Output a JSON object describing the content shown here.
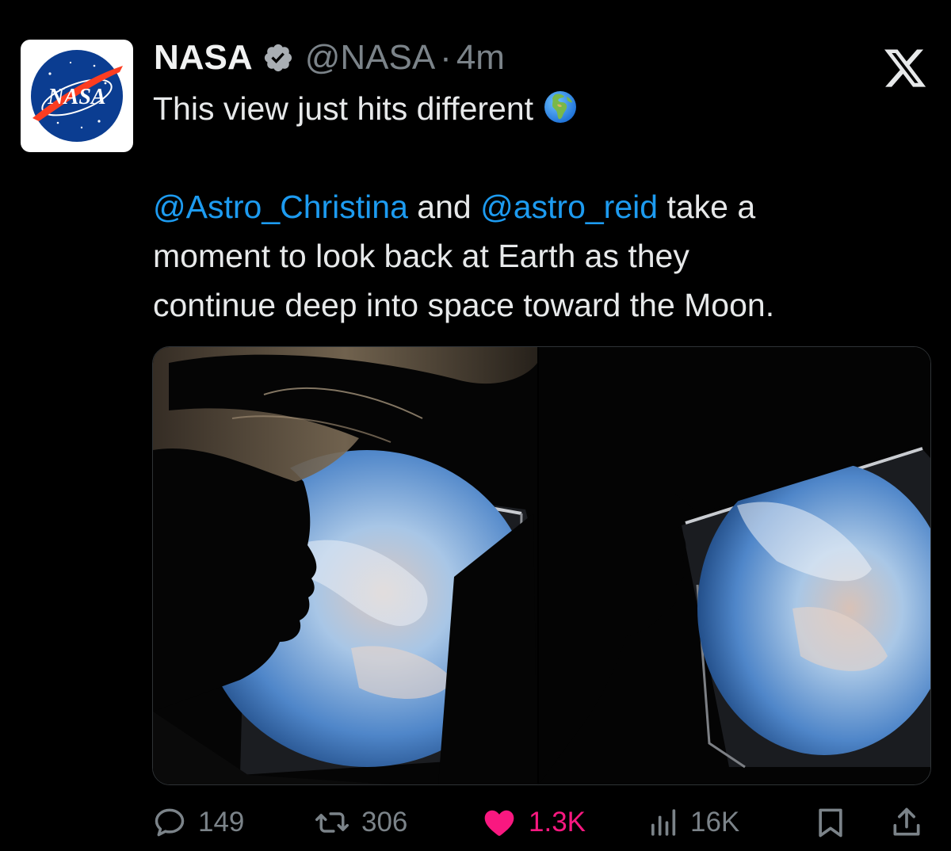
{
  "tweet": {
    "avatar": {
      "alt": "NASA logo",
      "logo_text": "NASA"
    },
    "author": {
      "display_name": "NASA",
      "handle": "@NASA",
      "verified": true
    },
    "separator": "·",
    "timestamp": "4m",
    "text": {
      "headline": "This view just hits different",
      "headline_emoji": "globe-europe-africa-icon",
      "mention_1": "@Astro_Christina",
      "word_and": " and ",
      "mention_2": "@astro_reid",
      "line2_rest": " take a",
      "line3": "moment to look back at Earth as they",
      "line4": "continue deep into space toward the Moon."
    },
    "media": [
      {
        "alt": "Astronaut silhouette in profile looking out an Orion window at Earth"
      },
      {
        "alt": "Second astronaut silhouette in profile looking at Earth through a window"
      }
    ],
    "metrics": {
      "replies": "149",
      "reposts": "306",
      "likes": "1.3K",
      "views": "16K"
    }
  },
  "colors": {
    "background": "#000000",
    "text": "#e7e9ea",
    "secondary": "#7b8389",
    "mention": "#1d9bf0",
    "like": "#f91880",
    "verified": "#a9aeb3"
  },
  "icons": {
    "platform": "x-logo-icon",
    "reply": "speech-bubble-icon",
    "repost": "repost-arrows-icon",
    "like": "heart-filled-icon",
    "views": "bar-chart-icon",
    "bookmark": "bookmark-icon",
    "share": "share-upload-icon"
  }
}
